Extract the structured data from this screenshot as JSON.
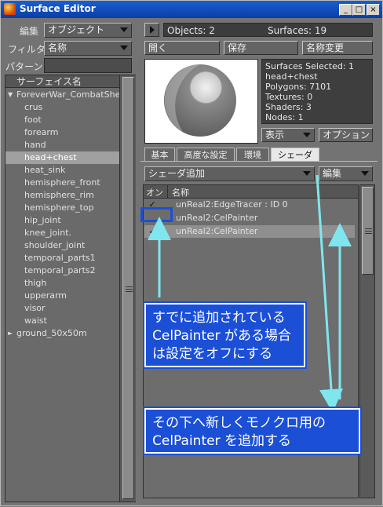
{
  "window": {
    "title": "Surface Editor",
    "controls": [
      "_",
      "□",
      "×"
    ]
  },
  "left": {
    "edit_label": "編集",
    "edit_value": "オブジェクト",
    "filter_label": "フィルタ",
    "filter_value": "名称",
    "pattern_label": "パターン",
    "pattern_value": "",
    "list_header": "サーフェイス名",
    "items": [
      {
        "label": "ForeverWar_CombatShell",
        "expander": "▼"
      },
      {
        "label": "crus"
      },
      {
        "label": "foot"
      },
      {
        "label": "forearm"
      },
      {
        "label": "hand"
      },
      {
        "label": "head+chest",
        "selected": true
      },
      {
        "label": "heat_sink"
      },
      {
        "label": "hemisphere_front"
      },
      {
        "label": "hemisphere_rim"
      },
      {
        "label": "hemisphere_top"
      },
      {
        "label": "hip_joint"
      },
      {
        "label": "knee_joint."
      },
      {
        "label": "shoulder_joint"
      },
      {
        "label": "temporal_parts1"
      },
      {
        "label": "temporal_parts2"
      },
      {
        "label": "thigh"
      },
      {
        "label": "upperarm"
      },
      {
        "label": "visor"
      },
      {
        "label": "waist"
      },
      {
        "label": "ground_50x50m",
        "expander": "►"
      }
    ]
  },
  "right": {
    "objects_text": "Objects: 2",
    "surfaces_text": "Surfaces: 19",
    "open_button": "開く",
    "save_button": "保存",
    "rename_button": "名称変更",
    "info": [
      "Surfaces Selected: 1",
      "head+chest",
      "Polygons: 7101",
      "Textures: 0",
      "Shaders: 3",
      "Nodes: 1"
    ],
    "display_dropdown": "表示",
    "options_button": "オプション",
    "tabs": [
      "基本",
      "高度な設定",
      "環境",
      "シェーダ"
    ],
    "active_tab": "シェーダ",
    "add_shader_dropdown": "シェーダ追加",
    "edit_dropdown": "編集",
    "col_on": "オン",
    "col_name": "名称",
    "shaders": [
      {
        "name": "unReal2:EdgeTracer : ID 0",
        "checked": true
      },
      {
        "name": "unReal2:CelPainter",
        "checked": false
      },
      {
        "name": "unReal2:CelPainter",
        "checked": true
      }
    ]
  },
  "annotations": {
    "callout1": [
      "すでに追加されている",
      "CelPainter がある場合",
      "は設定をオフにする"
    ],
    "callout2": [
      "その下へ新しくモノクロ用の",
      "CelPainter を追加する"
    ]
  },
  "colors": {
    "callout": "#1b4fd6",
    "arrow": "#7fe6ee",
    "titlebar": "#0a3ea8"
  }
}
